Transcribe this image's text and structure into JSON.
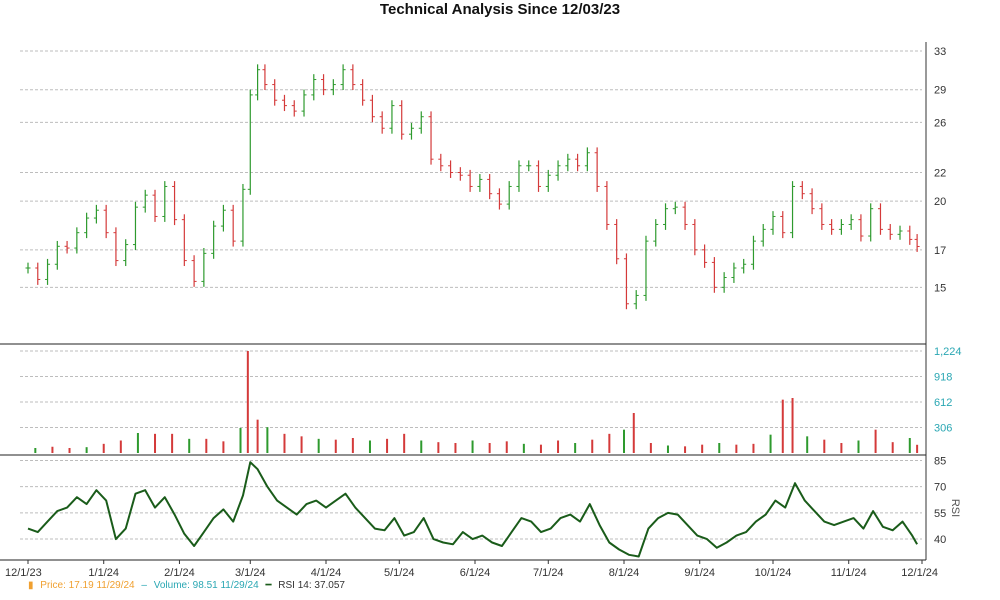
{
  "title": "Technical Analysis Since 12/03/23",
  "colors": {
    "up": "#2e9a2e",
    "down": "#d43a3a",
    "rsi_line": "#1a5c1a",
    "grid": "#bdbdbd",
    "price_axis_text": "#333333",
    "volume_axis_text": "#2aa7b3",
    "rsi_axis_text": "#333333"
  },
  "legend": {
    "price_marker": "▮",
    "price_text": "Price: 17.19  11/29/24",
    "volume_marker": "–",
    "volume_text": "Volume: 98.51  11/29/24",
    "rsi_marker": "━",
    "rsi_text": "RSI 14: 37.057"
  },
  "chart_data": {
    "type": "line",
    "title": "Technical Analysis Since 12/03/23",
    "x_ticks": [
      "12/1/23",
      "1/1/24",
      "2/1/24",
      "3/1/24",
      "4/1/24",
      "5/1/24",
      "6/1/24",
      "7/1/24",
      "8/1/24",
      "9/1/24",
      "10/1/24",
      "11/1/24",
      "12/1/24"
    ],
    "price": {
      "y_ticks": [
        15,
        17,
        20,
        22,
        26,
        29,
        33
      ],
      "ylim": [
        12.5,
        34
      ],
      "scale": "log",
      "series": [
        {
          "d": "2023-12-01",
          "v": 16.0
        },
        {
          "d": "2023-12-05",
          "v": 15.4
        },
        {
          "d": "2023-12-09",
          "v": 16.2
        },
        {
          "d": "2023-12-13",
          "v": 17.2
        },
        {
          "d": "2023-12-17",
          "v": 17.1
        },
        {
          "d": "2023-12-21",
          "v": 18.0
        },
        {
          "d": "2023-12-25",
          "v": 18.9
        },
        {
          "d": "2023-12-29",
          "v": 19.4
        },
        {
          "d": "2024-01-02",
          "v": 18.0
        },
        {
          "d": "2024-01-06",
          "v": 16.4
        },
        {
          "d": "2024-01-10",
          "v": 17.3
        },
        {
          "d": "2024-01-14",
          "v": 19.6
        },
        {
          "d": "2024-01-18",
          "v": 20.4
        },
        {
          "d": "2024-01-22",
          "v": 19.0
        },
        {
          "d": "2024-01-26",
          "v": 21.0
        },
        {
          "d": "2024-01-30",
          "v": 18.8
        },
        {
          "d": "2024-02-03",
          "v": 16.4
        },
        {
          "d": "2024-02-07",
          "v": 15.3
        },
        {
          "d": "2024-02-11",
          "v": 16.8
        },
        {
          "d": "2024-02-15",
          "v": 18.4
        },
        {
          "d": "2024-02-19",
          "v": 19.4
        },
        {
          "d": "2024-02-23",
          "v": 17.5
        },
        {
          "d": "2024-02-27",
          "v": 20.8
        },
        {
          "d": "2024-03-01",
          "v": 28.5
        },
        {
          "d": "2024-03-04",
          "v": 31.0
        },
        {
          "d": "2024-03-07",
          "v": 29.5
        },
        {
          "d": "2024-03-11",
          "v": 28.0
        },
        {
          "d": "2024-03-15",
          "v": 27.5
        },
        {
          "d": "2024-03-19",
          "v": 27.0
        },
        {
          "d": "2024-03-23",
          "v": 28.5
        },
        {
          "d": "2024-03-27",
          "v": 30.0
        },
        {
          "d": "2024-03-31",
          "v": 29.0
        },
        {
          "d": "2024-04-04",
          "v": 29.5
        },
        {
          "d": "2024-04-08",
          "v": 31.0
        },
        {
          "d": "2024-04-12",
          "v": 29.5
        },
        {
          "d": "2024-04-16",
          "v": 28.0
        },
        {
          "d": "2024-04-20",
          "v": 26.5
        },
        {
          "d": "2024-04-24",
          "v": 25.5
        },
        {
          "d": "2024-04-28",
          "v": 27.5
        },
        {
          "d": "2024-05-02",
          "v": 25.0
        },
        {
          "d": "2024-05-06",
          "v": 25.5
        },
        {
          "d": "2024-05-10",
          "v": 26.5
        },
        {
          "d": "2024-05-14",
          "v": 23.0
        },
        {
          "d": "2024-05-18",
          "v": 22.5
        },
        {
          "d": "2024-05-22",
          "v": 22.0
        },
        {
          "d": "2024-05-26",
          "v": 21.8
        },
        {
          "d": "2024-05-30",
          "v": 21.0
        },
        {
          "d": "2024-06-03",
          "v": 21.5
        },
        {
          "d": "2024-06-07",
          "v": 20.5
        },
        {
          "d": "2024-06-11",
          "v": 19.8
        },
        {
          "d": "2024-06-15",
          "v": 21.0
        },
        {
          "d": "2024-06-19",
          "v": 22.5
        },
        {
          "d": "2024-06-23",
          "v": 22.5
        },
        {
          "d": "2024-06-27",
          "v": 21.0
        },
        {
          "d": "2024-07-01",
          "v": 21.8
        },
        {
          "d": "2024-07-05",
          "v": 22.5
        },
        {
          "d": "2024-07-09",
          "v": 23.0
        },
        {
          "d": "2024-07-13",
          "v": 22.5
        },
        {
          "d": "2024-07-17",
          "v": 23.5
        },
        {
          "d": "2024-07-21",
          "v": 21.0
        },
        {
          "d": "2024-07-25",
          "v": 18.5
        },
        {
          "d": "2024-07-29",
          "v": 16.5
        },
        {
          "d": "2024-08-02",
          "v": 14.2
        },
        {
          "d": "2024-08-06",
          "v": 14.6
        },
        {
          "d": "2024-08-10",
          "v": 17.5
        },
        {
          "d": "2024-08-14",
          "v": 18.5
        },
        {
          "d": "2024-08-18",
          "v": 19.5
        },
        {
          "d": "2024-08-22",
          "v": 19.6
        },
        {
          "d": "2024-08-26",
          "v": 18.5
        },
        {
          "d": "2024-08-30",
          "v": 17.0
        },
        {
          "d": "2024-09-03",
          "v": 16.3
        },
        {
          "d": "2024-09-07",
          "v": 15.0
        },
        {
          "d": "2024-09-11",
          "v": 15.5
        },
        {
          "d": "2024-09-15",
          "v": 16.0
        },
        {
          "d": "2024-09-19",
          "v": 16.2
        },
        {
          "d": "2024-09-23",
          "v": 17.5
        },
        {
          "d": "2024-09-27",
          "v": 18.2
        },
        {
          "d": "2024-10-01",
          "v": 19.0
        },
        {
          "d": "2024-10-05",
          "v": 18.0
        },
        {
          "d": "2024-10-09",
          "v": 21.0
        },
        {
          "d": "2024-10-13",
          "v": 20.5
        },
        {
          "d": "2024-10-17",
          "v": 19.5
        },
        {
          "d": "2024-10-21",
          "v": 18.5
        },
        {
          "d": "2024-10-25",
          "v": 18.2
        },
        {
          "d": "2024-10-29",
          "v": 18.5
        },
        {
          "d": "2024-11-02",
          "v": 18.8
        },
        {
          "d": "2024-11-06",
          "v": 17.8
        },
        {
          "d": "2024-11-10",
          "v": 19.5
        },
        {
          "d": "2024-11-14",
          "v": 18.2
        },
        {
          "d": "2024-11-18",
          "v": 17.9
        },
        {
          "d": "2024-11-22",
          "v": 18.1
        },
        {
          "d": "2024-11-26",
          "v": 17.6
        },
        {
          "d": "2024-11-29",
          "v": 17.19
        }
      ]
    },
    "volume": {
      "y_ticks": [
        "306",
        "612",
        "918",
        "1,224"
      ],
      "ylim": [
        0,
        1224
      ],
      "series": [
        {
          "d": "2023-12-04",
          "v": 60
        },
        {
          "d": "2023-12-11",
          "v": 75
        },
        {
          "d": "2023-12-18",
          "v": 60
        },
        {
          "d": "2023-12-25",
          "v": 70
        },
        {
          "d": "2024-01-01",
          "v": 110
        },
        {
          "d": "2024-01-08",
          "v": 150
        },
        {
          "d": "2024-01-15",
          "v": 240
        },
        {
          "d": "2024-01-22",
          "v": 230
        },
        {
          "d": "2024-01-29",
          "v": 230
        },
        {
          "d": "2024-02-05",
          "v": 170
        },
        {
          "d": "2024-02-12",
          "v": 170
        },
        {
          "d": "2024-02-19",
          "v": 140
        },
        {
          "d": "2024-02-26",
          "v": 300
        },
        {
          "d": "2024-02-29",
          "v": 1224
        },
        {
          "d": "2024-03-04",
          "v": 400
        },
        {
          "d": "2024-03-08",
          "v": 310
        },
        {
          "d": "2024-03-15",
          "v": 230
        },
        {
          "d": "2024-03-22",
          "v": 200
        },
        {
          "d": "2024-03-29",
          "v": 170
        },
        {
          "d": "2024-04-05",
          "v": 160
        },
        {
          "d": "2024-04-12",
          "v": 180
        },
        {
          "d": "2024-04-19",
          "v": 150
        },
        {
          "d": "2024-04-26",
          "v": 170
        },
        {
          "d": "2024-05-03",
          "v": 230
        },
        {
          "d": "2024-05-10",
          "v": 150
        },
        {
          "d": "2024-05-17",
          "v": 130
        },
        {
          "d": "2024-05-24",
          "v": 120
        },
        {
          "d": "2024-05-31",
          "v": 150
        },
        {
          "d": "2024-06-07",
          "v": 120
        },
        {
          "d": "2024-06-14",
          "v": 140
        },
        {
          "d": "2024-06-21",
          "v": 110
        },
        {
          "d": "2024-06-28",
          "v": 100
        },
        {
          "d": "2024-07-05",
          "v": 150
        },
        {
          "d": "2024-07-12",
          "v": 120
        },
        {
          "d": "2024-07-19",
          "v": 160
        },
        {
          "d": "2024-07-26",
          "v": 230
        },
        {
          "d": "2024-08-01",
          "v": 280
        },
        {
          "d": "2024-08-05",
          "v": 480
        },
        {
          "d": "2024-08-12",
          "v": 120
        },
        {
          "d": "2024-08-19",
          "v": 90
        },
        {
          "d": "2024-08-26",
          "v": 80
        },
        {
          "d": "2024-09-02",
          "v": 100
        },
        {
          "d": "2024-09-09",
          "v": 120
        },
        {
          "d": "2024-09-16",
          "v": 100
        },
        {
          "d": "2024-09-23",
          "v": 110
        },
        {
          "d": "2024-09-30",
          "v": 220
        },
        {
          "d": "2024-10-05",
          "v": 640
        },
        {
          "d": "2024-10-09",
          "v": 660
        },
        {
          "d": "2024-10-15",
          "v": 200
        },
        {
          "d": "2024-10-22",
          "v": 160
        },
        {
          "d": "2024-10-29",
          "v": 120
        },
        {
          "d": "2024-11-05",
          "v": 150
        },
        {
          "d": "2024-11-12",
          "v": 280
        },
        {
          "d": "2024-11-19",
          "v": 130
        },
        {
          "d": "2024-11-26",
          "v": 180
        },
        {
          "d": "2024-11-29",
          "v": 98.51
        }
      ]
    },
    "rsi": {
      "y_ticks": [
        40,
        55,
        70,
        85
      ],
      "ylim": [
        28,
        87
      ],
      "axis_label": "RSI",
      "series": [
        {
          "d": "2023-12-01",
          "v": 46
        },
        {
          "d": "2023-12-05",
          "v": 44
        },
        {
          "d": "2023-12-09",
          "v": 50
        },
        {
          "d": "2023-12-13",
          "v": 56
        },
        {
          "d": "2023-12-17",
          "v": 58
        },
        {
          "d": "2023-12-21",
          "v": 64
        },
        {
          "d": "2023-12-25",
          "v": 60
        },
        {
          "d": "2023-12-29",
          "v": 68
        },
        {
          "d": "2024-01-02",
          "v": 62
        },
        {
          "d": "2024-01-06",
          "v": 40
        },
        {
          "d": "2024-01-10",
          "v": 46
        },
        {
          "d": "2024-01-14",
          "v": 66
        },
        {
          "d": "2024-01-18",
          "v": 68
        },
        {
          "d": "2024-01-22",
          "v": 58
        },
        {
          "d": "2024-01-26",
          "v": 64
        },
        {
          "d": "2024-01-30",
          "v": 54
        },
        {
          "d": "2024-02-03",
          "v": 43
        },
        {
          "d": "2024-02-07",
          "v": 36
        },
        {
          "d": "2024-02-11",
          "v": 44
        },
        {
          "d": "2024-02-15",
          "v": 52
        },
        {
          "d": "2024-02-19",
          "v": 57
        },
        {
          "d": "2024-02-23",
          "v": 50
        },
        {
          "d": "2024-02-27",
          "v": 65
        },
        {
          "d": "2024-03-01",
          "v": 84
        },
        {
          "d": "2024-03-04",
          "v": 80
        },
        {
          "d": "2024-03-08",
          "v": 70
        },
        {
          "d": "2024-03-12",
          "v": 62
        },
        {
          "d": "2024-03-16",
          "v": 58
        },
        {
          "d": "2024-03-20",
          "v": 54
        },
        {
          "d": "2024-03-24",
          "v": 60
        },
        {
          "d": "2024-03-28",
          "v": 62
        },
        {
          "d": "2024-04-01",
          "v": 58
        },
        {
          "d": "2024-04-05",
          "v": 62
        },
        {
          "d": "2024-04-09",
          "v": 66
        },
        {
          "d": "2024-04-13",
          "v": 58
        },
        {
          "d": "2024-04-17",
          "v": 52
        },
        {
          "d": "2024-04-21",
          "v": 46
        },
        {
          "d": "2024-04-25",
          "v": 45
        },
        {
          "d": "2024-04-29",
          "v": 52
        },
        {
          "d": "2024-05-03",
          "v": 42
        },
        {
          "d": "2024-05-07",
          "v": 44
        },
        {
          "d": "2024-05-11",
          "v": 52
        },
        {
          "d": "2024-05-15",
          "v": 40
        },
        {
          "d": "2024-05-19",
          "v": 38
        },
        {
          "d": "2024-05-23",
          "v": 37
        },
        {
          "d": "2024-05-27",
          "v": 44
        },
        {
          "d": "2024-05-31",
          "v": 40
        },
        {
          "d": "2024-06-04",
          "v": 42
        },
        {
          "d": "2024-06-08",
          "v": 38
        },
        {
          "d": "2024-06-12",
          "v": 36
        },
        {
          "d": "2024-06-16",
          "v": 44
        },
        {
          "d": "2024-06-20",
          "v": 52
        },
        {
          "d": "2024-06-24",
          "v": 50
        },
        {
          "d": "2024-06-28",
          "v": 44
        },
        {
          "d": "2024-07-02",
          "v": 46
        },
        {
          "d": "2024-07-06",
          "v": 52
        },
        {
          "d": "2024-07-10",
          "v": 54
        },
        {
          "d": "2024-07-14",
          "v": 50
        },
        {
          "d": "2024-07-18",
          "v": 60
        },
        {
          "d": "2024-07-22",
          "v": 48
        },
        {
          "d": "2024-07-26",
          "v": 38
        },
        {
          "d": "2024-07-30",
          "v": 34
        },
        {
          "d": "2024-08-03",
          "v": 31
        },
        {
          "d": "2024-08-07",
          "v": 30
        },
        {
          "d": "2024-08-11",
          "v": 46
        },
        {
          "d": "2024-08-15",
          "v": 52
        },
        {
          "d": "2024-08-19",
          "v": 55
        },
        {
          "d": "2024-08-23",
          "v": 54
        },
        {
          "d": "2024-08-27",
          "v": 48
        },
        {
          "d": "2024-08-31",
          "v": 42
        },
        {
          "d": "2024-09-04",
          "v": 40
        },
        {
          "d": "2024-09-08",
          "v": 35
        },
        {
          "d": "2024-09-12",
          "v": 38
        },
        {
          "d": "2024-09-16",
          "v": 42
        },
        {
          "d": "2024-09-20",
          "v": 44
        },
        {
          "d": "2024-09-24",
          "v": 50
        },
        {
          "d": "2024-09-28",
          "v": 54
        },
        {
          "d": "2024-10-02",
          "v": 62
        },
        {
          "d": "2024-10-06",
          "v": 58
        },
        {
          "d": "2024-10-10",
          "v": 72
        },
        {
          "d": "2024-10-14",
          "v": 62
        },
        {
          "d": "2024-10-18",
          "v": 56
        },
        {
          "d": "2024-10-22",
          "v": 50
        },
        {
          "d": "2024-10-26",
          "v": 48
        },
        {
          "d": "2024-10-30",
          "v": 50
        },
        {
          "d": "2024-11-03",
          "v": 52
        },
        {
          "d": "2024-11-07",
          "v": 46
        },
        {
          "d": "2024-11-11",
          "v": 56
        },
        {
          "d": "2024-11-15",
          "v": 47
        },
        {
          "d": "2024-11-19",
          "v": 45
        },
        {
          "d": "2024-11-23",
          "v": 50
        },
        {
          "d": "2024-11-27",
          "v": 42
        },
        {
          "d": "2024-11-29",
          "v": 37.057
        }
      ]
    }
  }
}
